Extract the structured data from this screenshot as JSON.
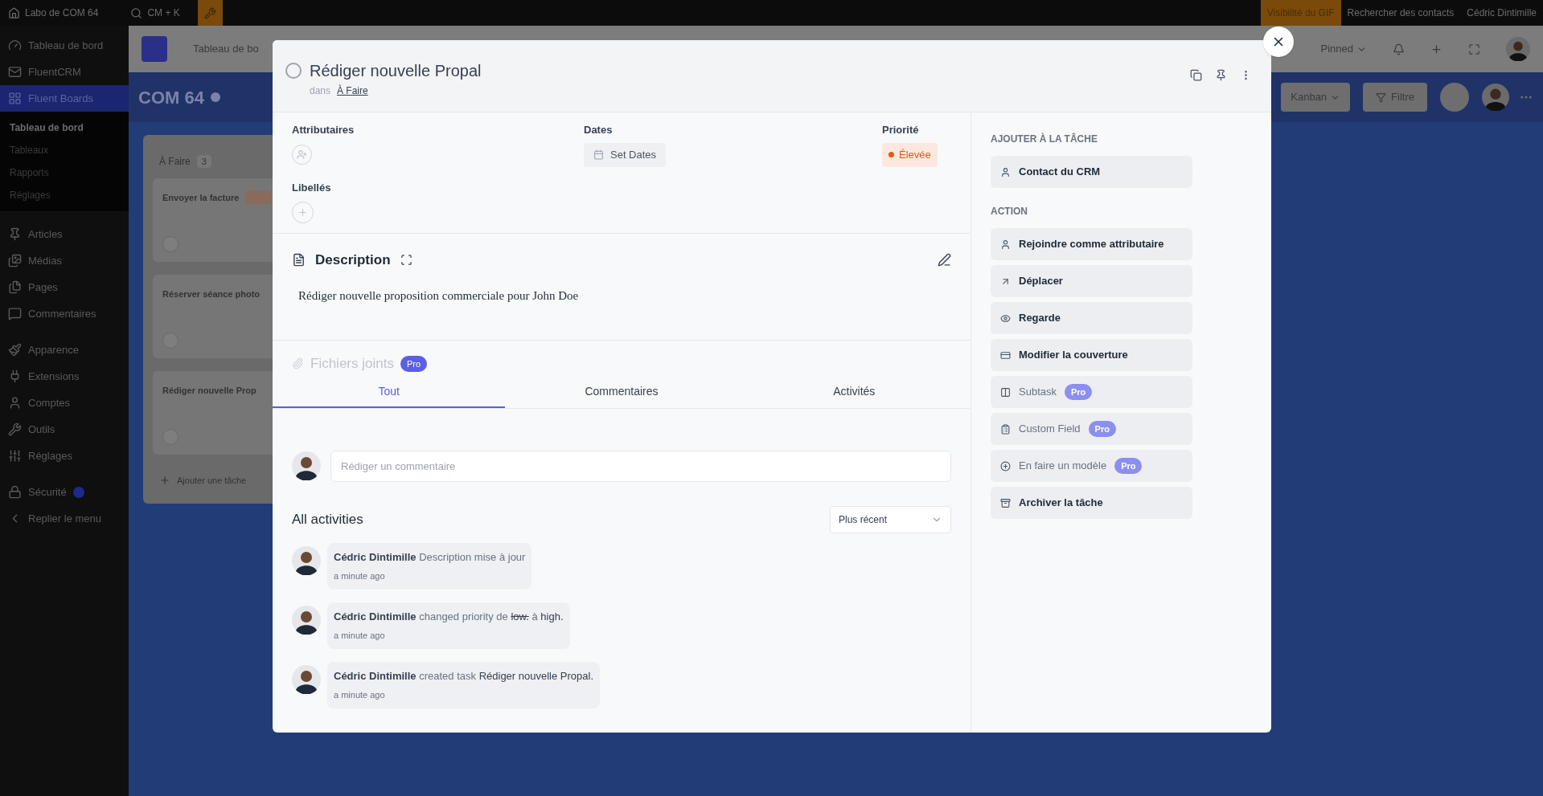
{
  "admin_bar": {
    "site": "Labo de COM 64",
    "search": "CM + K",
    "right": [
      {
        "label": "Visibilité du GIF",
        "highlight": true
      },
      {
        "label": "Rechercher des contacts",
        "highlight": false
      },
      {
        "label": "Cédric Dintimille",
        "highlight": false
      }
    ]
  },
  "sidebar": {
    "sections": [
      {
        "items": [
          {
            "label": "Tableau de bord",
            "selected": false
          },
          {
            "label": "FluentCRM",
            "selected": false
          },
          {
            "label": "Fluent Boards",
            "selected": true,
            "children": [
              {
                "label": "Tableau de bord",
                "selected": true
              },
              {
                "label": "Tableaux",
                "selected": false
              },
              {
                "label": "Rapports",
                "selected": false
              },
              {
                "label": "Réglages",
                "selected": false
              }
            ]
          }
        ]
      },
      {
        "items": [
          {
            "label": "Articles",
            "selected": false
          },
          {
            "label": "Médias",
            "selected": false
          },
          {
            "label": "Pages",
            "selected": false
          },
          {
            "label": "Commentaires",
            "selected": false
          }
        ]
      },
      {
        "items": [
          {
            "label": "Apparence",
            "selected": false
          },
          {
            "label": "Extensions",
            "selected": false
          },
          {
            "label": "Comptes",
            "selected": false
          },
          {
            "label": "Outils",
            "selected": false
          },
          {
            "label": "Réglages",
            "selected": false
          }
        ]
      },
      {
        "items": [
          {
            "label": "Sécurité",
            "selected": false,
            "notification": true
          },
          {
            "label": "Replier le menu",
            "selected": false
          }
        ]
      }
    ]
  },
  "board": {
    "nav": "Tableau de bo",
    "pinned": "Pinned",
    "title": "COM 64",
    "view": "Kanban",
    "filter": "Filtre",
    "column": {
      "title": "À Faire",
      "count": "3",
      "cards": [
        {
          "title": "Envoyer la facture",
          "tag": true
        },
        {
          "title": "Réserver séance photo",
          "tag": false
        },
        {
          "title": "Rédiger nouvelle Prop",
          "tag": false
        }
      ],
      "add": "Ajouter une tâche"
    }
  },
  "task": {
    "title": "Rédiger nouvelle Propal",
    "completed": false,
    "list_prefix": "dans",
    "list": "À Faire",
    "assignees_label": "Attributaires",
    "dates_label": "Dates",
    "dates_button": "Set Dates",
    "priority_label": "Priorité",
    "priority": {
      "label": "Élevée",
      "color": "#e8590c"
    },
    "labels_label": "Libellés",
    "description_title": "Description",
    "description": "Rédiger nouvelle proposition commerciale pour John Doe",
    "attachments": {
      "label": "Fichiers joints",
      "badge": "Pro"
    },
    "tabs": [
      {
        "label": "Tout",
        "selected": true
      },
      {
        "label": "Commentaires",
        "selected": false
      },
      {
        "label": "Activités",
        "selected": false
      }
    ],
    "comment": {
      "placeholder": "Rédiger un commentaire"
    },
    "activities_title": "All activities",
    "sort": "Plus récent",
    "activities": [
      {
        "parts": [
          {
            "kind": "actor",
            "text": "Cédric Dintimille"
          },
          {
            "kind": "verb",
            "text": "Description mise à jour"
          }
        ],
        "time": "a minute ago"
      },
      {
        "parts": [
          {
            "kind": "actor",
            "text": "Cédric Dintimille"
          },
          {
            "kind": "verb",
            "text": "changed priority de"
          },
          {
            "kind": "old",
            "text": "low."
          },
          {
            "kind": "verb",
            "text": "à"
          },
          {
            "kind": "value",
            "text": "high."
          }
        ],
        "time": "a minute ago"
      },
      {
        "parts": [
          {
            "kind": "actor",
            "text": "Cédric Dintimille"
          },
          {
            "kind": "verb",
            "text": "created task"
          },
          {
            "kind": "value",
            "text": "Rédiger nouvelle Propal."
          }
        ],
        "time": "a minute ago"
      }
    ],
    "panel": [
      {
        "heading": "AJOUTER À LA TÂCHE",
        "actions": [
          {
            "label": "Contact du CRM",
            "pro": false
          }
        ]
      },
      {
        "heading": "ACTION",
        "actions": [
          {
            "label": "Rejoindre comme attributaire",
            "pro": false
          },
          {
            "label": "Déplacer",
            "pro": false
          },
          {
            "label": "Regarde",
            "pro": false
          },
          {
            "label": "Modifier la couverture",
            "pro": false
          },
          {
            "label": "Subtask",
            "pro": true,
            "badge": "Pro"
          },
          {
            "label": "Custom Field",
            "pro": true,
            "badge": "Pro"
          },
          {
            "label": "En faire un modèle",
            "pro": true,
            "badge": "Pro"
          },
          {
            "label": "Archiver la tâche",
            "pro": false
          }
        ]
      }
    ]
  }
}
